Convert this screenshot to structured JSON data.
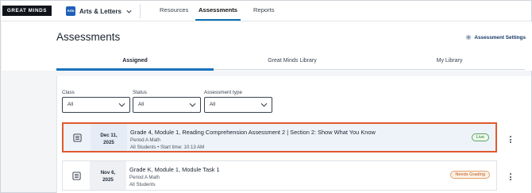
{
  "brand": {
    "logo_text": "GREAT MINDS"
  },
  "subject": {
    "icon_text": "Arts",
    "label": "Arts & Letters"
  },
  "top_tabs": [
    {
      "label": "Resources",
      "active": false
    },
    {
      "label": "Assessments",
      "active": true
    },
    {
      "label": "Reports",
      "active": false
    }
  ],
  "header": {
    "title": "Assessments",
    "settings_label": "Assessment Settings"
  },
  "sub_tabs": [
    {
      "label": "Assigned",
      "active": true
    },
    {
      "label": "Great Minds Library",
      "active": false
    },
    {
      "label": "My Library",
      "active": false
    }
  ],
  "filters": [
    {
      "label": "Class",
      "value": "All"
    },
    {
      "label": "Status",
      "value": "All"
    },
    {
      "label": "Assessment type",
      "value": "All"
    }
  ],
  "assessments": [
    {
      "date_line1": "Dec 11,",
      "date_line2": "2025",
      "title": "Grade 4, Module 1, Reading Comprehension Assessment 2 | Section 2: Show What You Know",
      "class_name": "Period A Math",
      "details": "All Students • Start time: 10:13 AM",
      "status": "Live",
      "highlighted": true
    },
    {
      "date_line1": "Nov 6,",
      "date_line2": "2025",
      "title": "Grade K, Module 1, Module Task 1",
      "class_name": "Period A Math",
      "details": "All Students",
      "status": "Needs Grading",
      "highlighted": false
    }
  ],
  "colors": {
    "accent": "#1873c0",
    "highlight_border": "#e05a2e",
    "live": "#2e7d32",
    "needs_grading": "#b85a1a"
  }
}
